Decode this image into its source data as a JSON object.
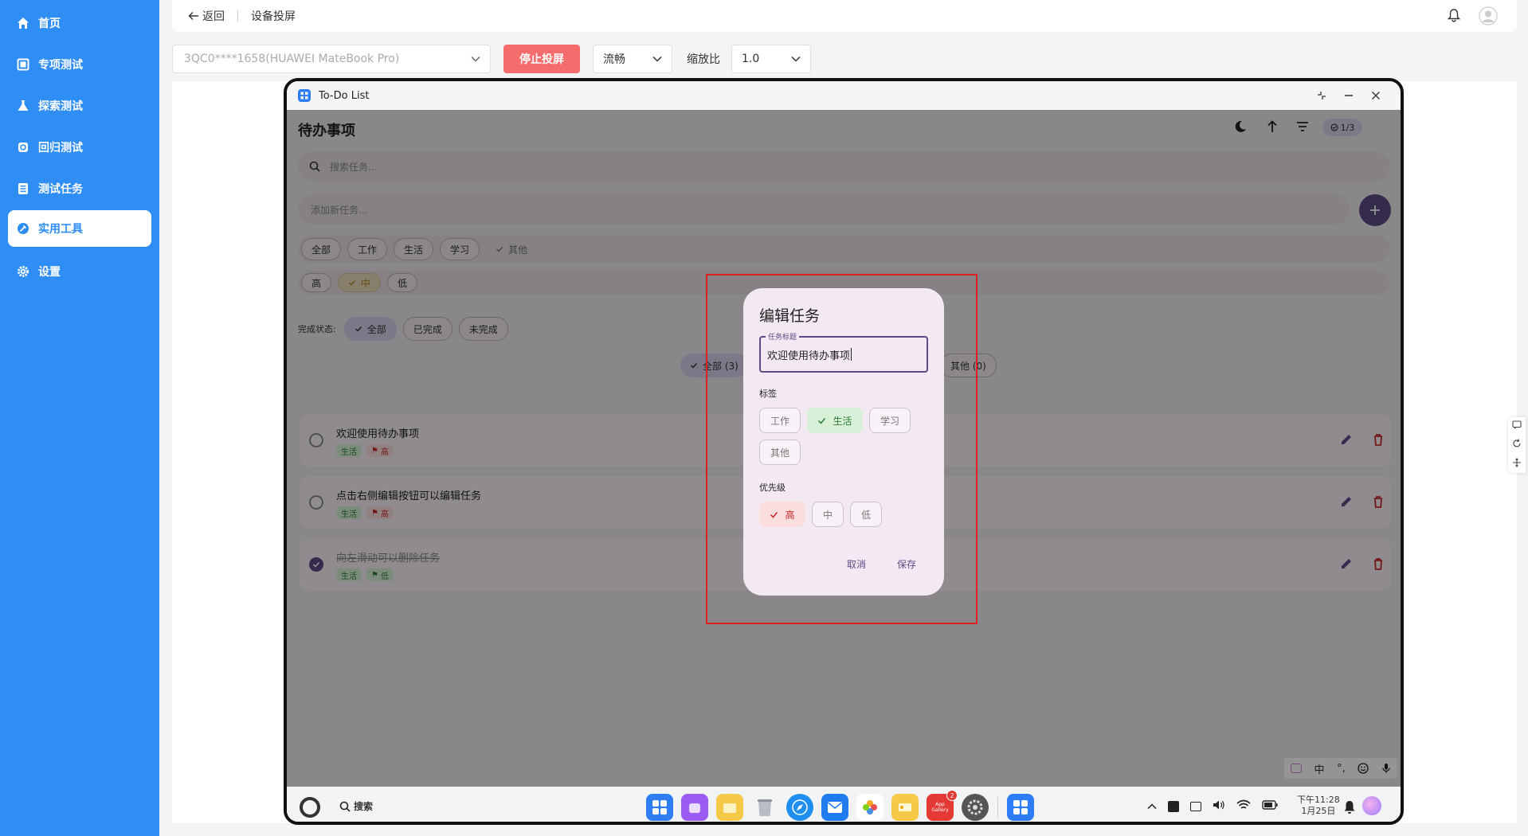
{
  "sidebar": {
    "items": [
      {
        "label": "首页",
        "icon": "home-icon"
      },
      {
        "label": "专项测试",
        "icon": "square-icon"
      },
      {
        "label": "探索测试",
        "icon": "flask-icon"
      },
      {
        "label": "回归测试",
        "icon": "refresh-icon"
      },
      {
        "label": "测试任务",
        "icon": "list-icon"
      },
      {
        "label": "实用工具",
        "icon": "tool-icon",
        "active": true
      },
      {
        "label": "设置",
        "icon": "gear-icon"
      }
    ]
  },
  "topbar": {
    "back_label": "返回",
    "title": "设备投屏"
  },
  "toolbar": {
    "device_value": "3QC0****1658(HUAWEI MateBook Pro)",
    "stop_label": "停止投屏",
    "quality_value": "流畅",
    "scale_label": "缩放比",
    "scale_value": "1.0"
  },
  "window": {
    "title": "To-Do List"
  },
  "app": {
    "title": "待办事项",
    "count_badge": "1/3",
    "search_placeholder": "搜索任务...",
    "add_placeholder": "添加新任务...",
    "tags": [
      "全部",
      "工作",
      "生活",
      "学习",
      "其他"
    ],
    "priorities": [
      "高",
      "中",
      "低"
    ],
    "status_label": "完成状态:",
    "status_options": [
      "全部",
      "已完成",
      "未完成"
    ],
    "summary_all": "全部 (3)",
    "summary_other": "其他 (0)",
    "todos": [
      {
        "title": "欢迎使用待办事项",
        "tag": "生活",
        "priority": "高",
        "done": false
      },
      {
        "title": "点击右侧编辑按钮可以编辑任务",
        "tag": "生活",
        "priority": "高",
        "done": false
      },
      {
        "title": "向左滑动可以删除任务",
        "tag": "生活",
        "priority": "低",
        "done": true
      }
    ]
  },
  "dialog": {
    "title": "编辑任务",
    "field_label": "任务标题",
    "field_value": "欢迎使用待办事项",
    "tags_label": "标签",
    "tags": [
      "工作",
      "生活",
      "学习",
      "其他"
    ],
    "selected_tag": "生活",
    "priority_label": "优先级",
    "priorities": [
      "高",
      "中",
      "低"
    ],
    "selected_priority": "高",
    "cancel_label": "取消",
    "save_label": "保存"
  },
  "taskbar": {
    "search_label": "搜索",
    "time": "下午11:28",
    "date": "1月25日",
    "badge_count": "2",
    "app_gallery_label": "App Gallery"
  },
  "ime": {
    "lang": "中",
    "punct": "°,"
  },
  "colors": {
    "sidebar": "#2e8ef5",
    "stop": "#f56c6c",
    "accent": "#5b4a86",
    "danger": "#c62828"
  }
}
